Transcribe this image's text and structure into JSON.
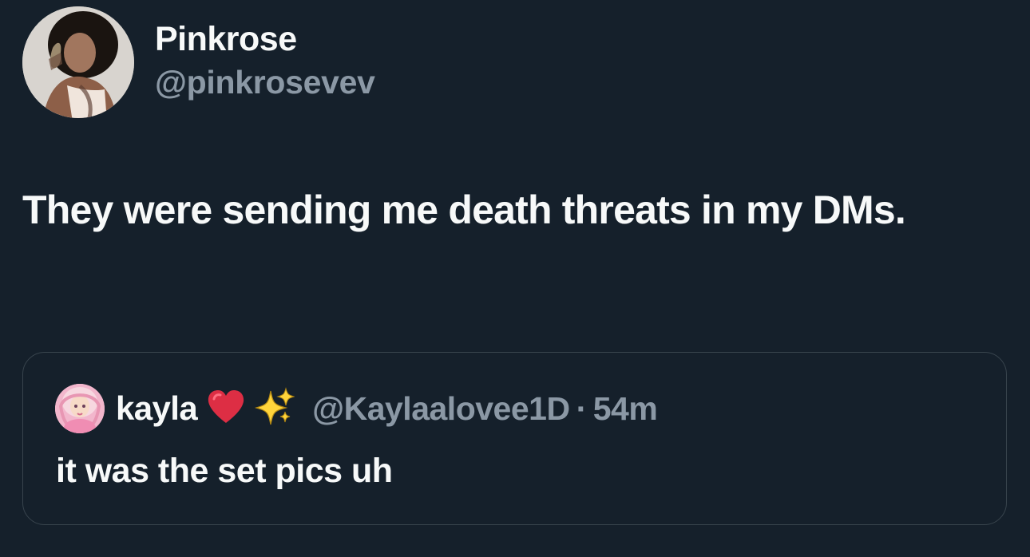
{
  "tweet": {
    "author": {
      "display_name": "Pinkrose",
      "handle": "@pinkrosevev",
      "avatar_icon": "profile-photo"
    },
    "text": "They were sending me death threats in my DMs."
  },
  "quote": {
    "author": {
      "display_name": "kayla",
      "emoji": [
        "red-heart-icon",
        "sparkles-icon"
      ],
      "handle": "@Kaylaalovee1D",
      "separator": "·",
      "time": "54m",
      "avatar_icon": "doll-avatar"
    },
    "text": "it was the set pics uh"
  },
  "colors": {
    "background": "#15202b",
    "primary_text": "#f7f9f9",
    "secondary_text": "#8b98a5",
    "border": "#38444d"
  }
}
